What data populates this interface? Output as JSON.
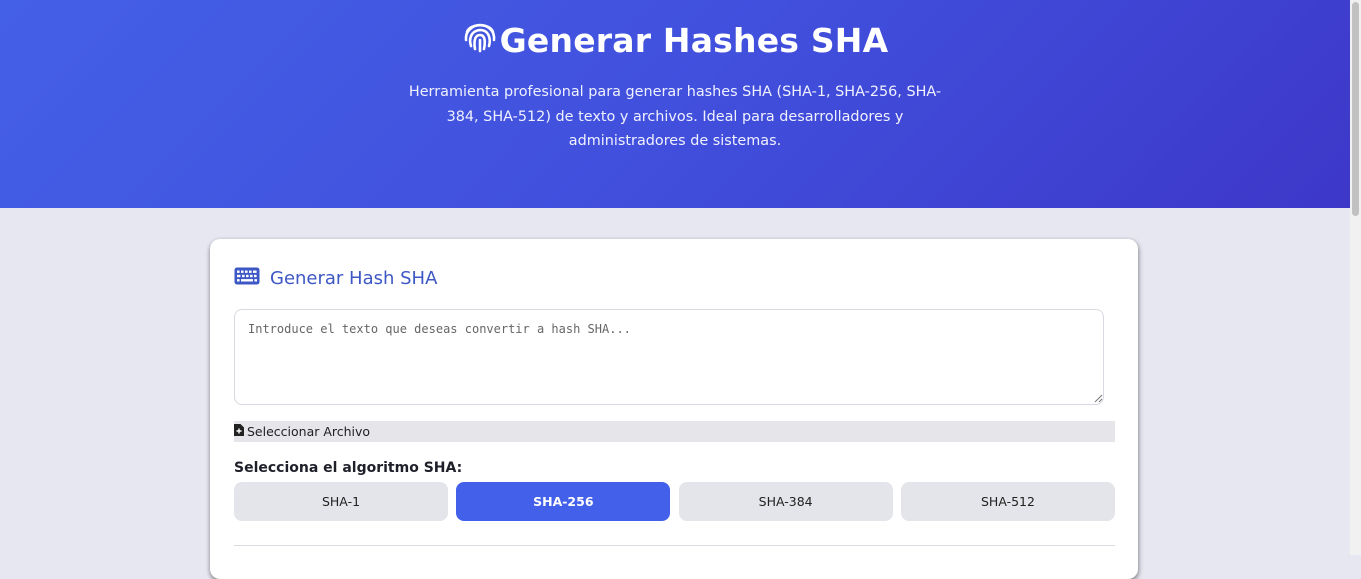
{
  "header": {
    "title": "Generar Hashes SHA",
    "description": "Herramienta profesional para generar hashes SHA (SHA-1, SHA-256, SHA-384, SHA-512) de texto y archivos. Ideal para desarrolladores y administradores de sistemas.",
    "icon": "fingerprint-icon"
  },
  "card": {
    "title": "Generar Hash SHA",
    "icon": "keyboard-icon",
    "input_placeholder": "Introduce el texto que deseas convertir a hash SHA...",
    "input_value": "",
    "file_button_label": "Seleccionar Archivo",
    "file_icon": "file-plus-icon",
    "algorithm_label": "Selecciona el algoritmo SHA:",
    "algorithms": [
      {
        "label": "SHA-1",
        "selected": false
      },
      {
        "label": "SHA-256",
        "selected": true
      },
      {
        "label": "SHA-384",
        "selected": false
      },
      {
        "label": "SHA-512",
        "selected": false
      }
    ]
  },
  "colors": {
    "accent": "#4360ea",
    "header_gradient_start": "#4460e6",
    "header_gradient_end": "#3d37c8",
    "card_title": "#3d57c4",
    "page_background": "#e6e7f1"
  }
}
